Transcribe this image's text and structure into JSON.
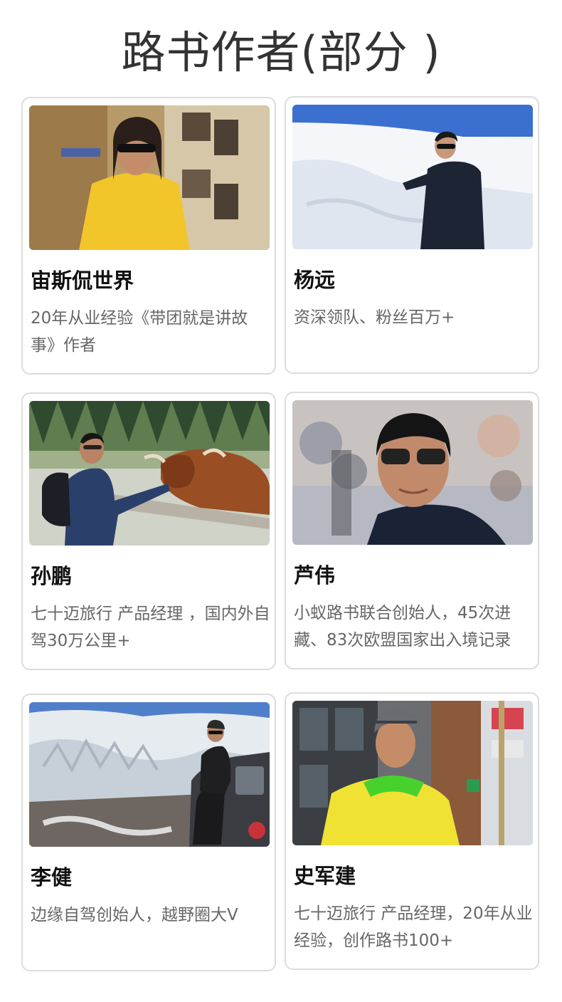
{
  "page": {
    "title": "路书作者(部分 )"
  },
  "authors": [
    {
      "name": "宙斯侃世界",
      "desc": "20年从业经验《带团就是讲故事》作者",
      "photo_icon": "portrait-yellow-polo-photo"
    },
    {
      "name": "杨远",
      "desc": "资深领队、粉丝百万+",
      "photo_icon": "portrait-snow-field-photo"
    },
    {
      "name": "孙鹏",
      "desc": "七十迈旅行 产品经理 ，国内外自驾30万公里+",
      "photo_icon": "portrait-highland-cow-photo"
    },
    {
      "name": "芦伟",
      "desc": "小蚁路书联合创始人，45次进藏、83次欧盟国家出入境记录",
      "photo_icon": "portrait-sunglasses-closeup-photo"
    },
    {
      "name": "李健",
      "desc": "边缘自驾创始人，越野圈大V",
      "photo_icon": "portrait-glacier-jeep-photo"
    },
    {
      "name": "史军建",
      "desc": "七十迈旅行 产品经理，20年从业经验，创作路书100+",
      "photo_icon": "portrait-yellow-jacket-city-photo"
    }
  ]
}
